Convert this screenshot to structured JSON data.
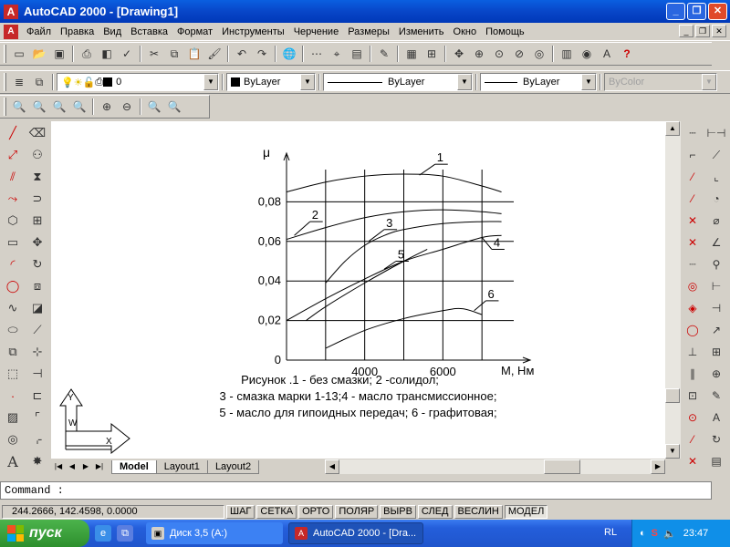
{
  "window": {
    "title": "AutoCAD 2000 - [Drawing1]",
    "controls": {
      "minimize": "_",
      "restore": "❐",
      "close": "✕"
    }
  },
  "menu": {
    "items": [
      "Файл",
      "Правка",
      "Вид",
      "Вставка",
      "Формат",
      "Инструменты",
      "Черчение",
      "Размеры",
      "Изменить",
      "Окно",
      "Помощь"
    ]
  },
  "toolbar_standard": {
    "icons": [
      "new-icon",
      "open-icon",
      "save-icon",
      "print-icon",
      "preview-icon",
      "spell-icon",
      "cut-icon",
      "copy-icon",
      "paste-icon",
      "match-icon",
      "undo-icon",
      "redo-icon",
      "web-icon",
      "snap-icon",
      "pick-icon",
      "measure-icon",
      "pencil-icon",
      "properties-icon",
      "design-center-icon",
      "pan-icon",
      "zoom-realtime-icon",
      "zoom-window-icon",
      "zoom-previous-icon",
      "zoom-extents-icon",
      "db-icon",
      "database-icon",
      "text-icon",
      "help-icon"
    ]
  },
  "toolbar_properties": {
    "layer_value": "0",
    "color_value": "ByLayer",
    "linetype_value": "ByLayer",
    "lineweight_value": "ByLayer",
    "plotstyle_value": "ByColor"
  },
  "tabs": {
    "items": [
      "Model",
      "Layout1",
      "Layout2"
    ],
    "active": "Model"
  },
  "command": {
    "prompt": "Command :"
  },
  "status": {
    "coords": "244.2666, 142.4598, 0.0000",
    "toggles": [
      "ШАГ",
      "СЕТКА",
      "ОРТО",
      "ПОЛЯР",
      "ВЫРВ",
      "СЛЕД",
      "ВЕСЛИН",
      "МОДЕЛ"
    ],
    "pressed": "МОДЕЛ"
  },
  "taskbar": {
    "start_label": "пуск",
    "tasks": [
      "Диск 3,5 (A:)",
      "AutoCAD 2000 - [Dra..."
    ],
    "lang": "RL",
    "clock": "23:47"
  },
  "drawing": {
    "ucs": {
      "y": "Y",
      "w": "W",
      "x": "X"
    },
    "caption_lines": [
      "Рисунок   .1 - без смазки; 2 -солидол;",
      "3 - смазка марки 1-13;4 - масло трансмиссионное;",
      "5 - масло для гипоидных передач; 6 - графитовая;"
    ]
  },
  "chart_data": {
    "type": "line",
    "xlabel": "М, Нм",
    "ylabel": "μ",
    "x_ticks": [
      "4000",
      "6000"
    ],
    "y_ticks": [
      "0",
      "0,02",
      "0,04",
      "0,06",
      "0,08"
    ],
    "xlim": [
      2000,
      8000
    ],
    "ylim": [
      0,
      0.1
    ],
    "series": [
      {
        "name": "1",
        "x": [
          2000,
          3000,
          4000,
          5000,
          6000,
          7000,
          7500
        ],
        "y": [
          0.085,
          0.09,
          0.093,
          0.094,
          0.093,
          0.088,
          0.085
        ]
      },
      {
        "name": "2",
        "x": [
          2000,
          3000,
          4000,
          5000,
          6000,
          7000,
          7500
        ],
        "y": [
          0.061,
          0.067,
          0.072,
          0.075,
          0.076,
          0.075,
          0.074
        ]
      },
      {
        "name": "3",
        "x": [
          3000,
          3500,
          4000,
          4500,
          5000,
          6000,
          7000,
          7500
        ],
        "y": [
          0.039,
          0.05,
          0.058,
          0.063,
          0.066,
          0.069,
          0.07,
          0.07
        ]
      },
      {
        "name": "4",
        "x": [
          2000,
          3000,
          4000,
          5000,
          6000,
          7000,
          7500
        ],
        "y": [
          0.02,
          0.031,
          0.041,
          0.05,
          0.056,
          0.062,
          0.063
        ]
      },
      {
        "name": "5",
        "x": [
          2500,
          3000,
          4000,
          5000,
          5600
        ],
        "y": [
          0.02,
          0.027,
          0.039,
          0.05,
          0.056
        ]
      },
      {
        "name": "6",
        "x": [
          3000,
          4000,
          5000,
          6000,
          6500,
          7000
        ],
        "y": [
          0.006,
          0.015,
          0.021,
          0.025,
          0.026,
          0.023
        ]
      }
    ]
  }
}
